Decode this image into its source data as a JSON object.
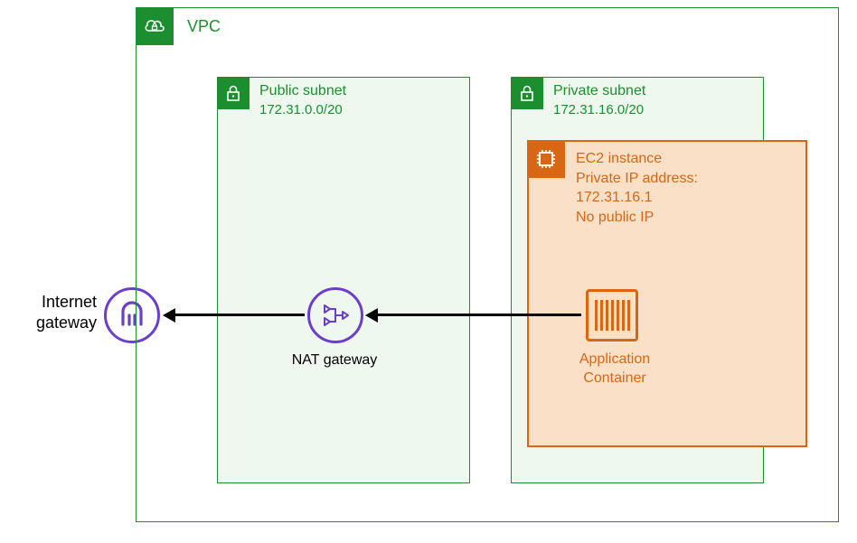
{
  "vpc": {
    "label": "VPC"
  },
  "public_subnet": {
    "title": "Public subnet",
    "cidr": "172.31.0.0/20"
  },
  "private_subnet": {
    "title": "Private subnet",
    "cidr": "172.31.16.0/20"
  },
  "ec2": {
    "title": "EC2 instance",
    "line2": "Private IP address:",
    "ip": "172.31.16.1",
    "no_public": "No public IP"
  },
  "app_container": {
    "label1": "Application",
    "label2": "Container"
  },
  "nat": {
    "label": "NAT gateway"
  },
  "igw": {
    "label1": "Internet",
    "label2": "gateway"
  }
}
